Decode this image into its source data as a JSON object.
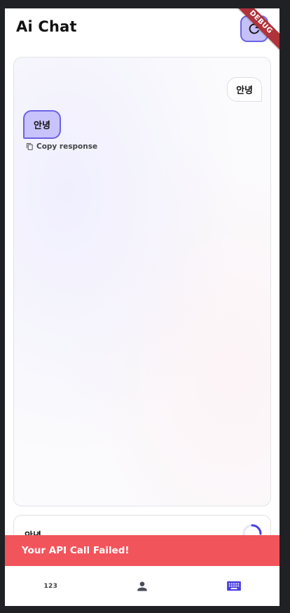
{
  "header": {
    "title": "Ai Chat",
    "refresh_icon": "refresh-icon"
  },
  "debug_banner": "DEBUG",
  "chat": {
    "messages": [
      {
        "role": "user",
        "text": "안녕"
      },
      {
        "role": "assistant",
        "text": "안녕"
      }
    ],
    "copy_label": "Copy response",
    "copy_icon": "copy-icon"
  },
  "input": {
    "value": "안녕",
    "status_icon": "loading-spinner"
  },
  "snackbar": {
    "message": "Your API Call Failed!"
  },
  "bottom_nav": {
    "items": [
      {
        "label": "123",
        "icon": "numbers-icon"
      },
      {
        "label": "",
        "icon": "person-icon"
      },
      {
        "label": "",
        "icon": "keyboard-icon",
        "active": true
      }
    ]
  },
  "colors": {
    "accent": "#6c62e7",
    "accent_light": "#c8c3fa",
    "error": "#f2545c",
    "background": "#202124"
  }
}
